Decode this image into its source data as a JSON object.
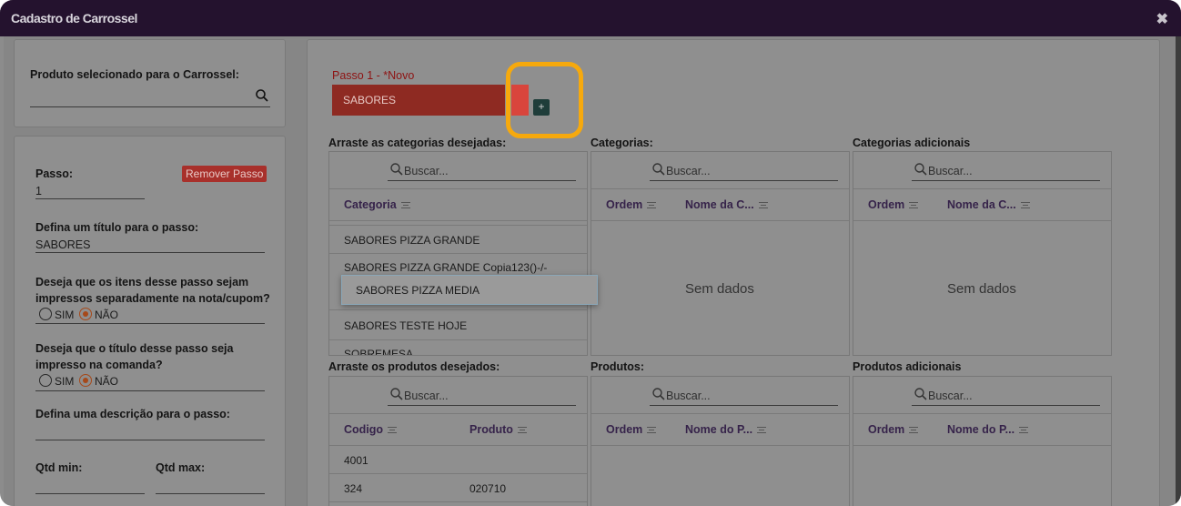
{
  "window": {
    "title": "Cadastro de Carrossel"
  },
  "product_panel": {
    "label": "Produto selecionado para o Carrossel:",
    "value": ""
  },
  "step_form": {
    "passo_label": "Passo:",
    "passo_value": "1",
    "remove_button": "Remover Passo",
    "titulo_label": "Defina um título para o passo:",
    "titulo_value": "SABORES",
    "impressos_question": "Deseja que os itens desse passo sejam impressos separadamente na nota/cupom?",
    "impressos_sim": "SIM",
    "impressos_nao": "NÃO",
    "impressos_selected": "NÃO",
    "comanda_question": "Deseja que o título desse passo seja impresso na comanda?",
    "comanda_sim": "SIM",
    "comanda_nao": "NÃO",
    "comanda_selected": "NÃO",
    "descricao_label": "Defina uma descrição para o passo:",
    "qtd_min_label": "Qtd min:",
    "qtd_max_label": "Qtd max:"
  },
  "steps": {
    "tab_title": "Passo 1 - *Novo",
    "tab_label": "SABORES",
    "add_button": "+"
  },
  "categories_section": {
    "drag_label": "Arraste as categorias desejadas:",
    "categorias_label": "Categorias:",
    "adicionais_label": "Categorias adicionais",
    "search_placeholder": "Buscar...",
    "source_header": "Categoria",
    "ordem_header": "Ordem",
    "nome_header": "Nome da C...",
    "no_data": "Sem dados",
    "rows": [
      "SABORES PIZZA GRANDE",
      "SABORES PIZZA GRANDE Copia123()-/-",
      "SABORES TESTE HOJE",
      "SOBREMESA"
    ],
    "dragging_item": "SABORES PIZZA MEDIA"
  },
  "products_section": {
    "drag_label": "Arraste os produtos desejados:",
    "produtos_label": "Produtos:",
    "adicionais_label": "Produtos adicionais",
    "search_placeholder": "Buscar...",
    "codigo_header": "Codigo",
    "produto_header": "Produto",
    "ordem_header": "Ordem",
    "nome_header": "Nome do P...",
    "rows": [
      {
        "codigo": "4001",
        "produto": ""
      },
      {
        "codigo": "324",
        "produto": "020710"
      }
    ]
  },
  "colors": {
    "titlebar": "#24122e",
    "accent_red": "#a8302b",
    "highlight": "#f6a90d",
    "overlay": "#868686"
  }
}
